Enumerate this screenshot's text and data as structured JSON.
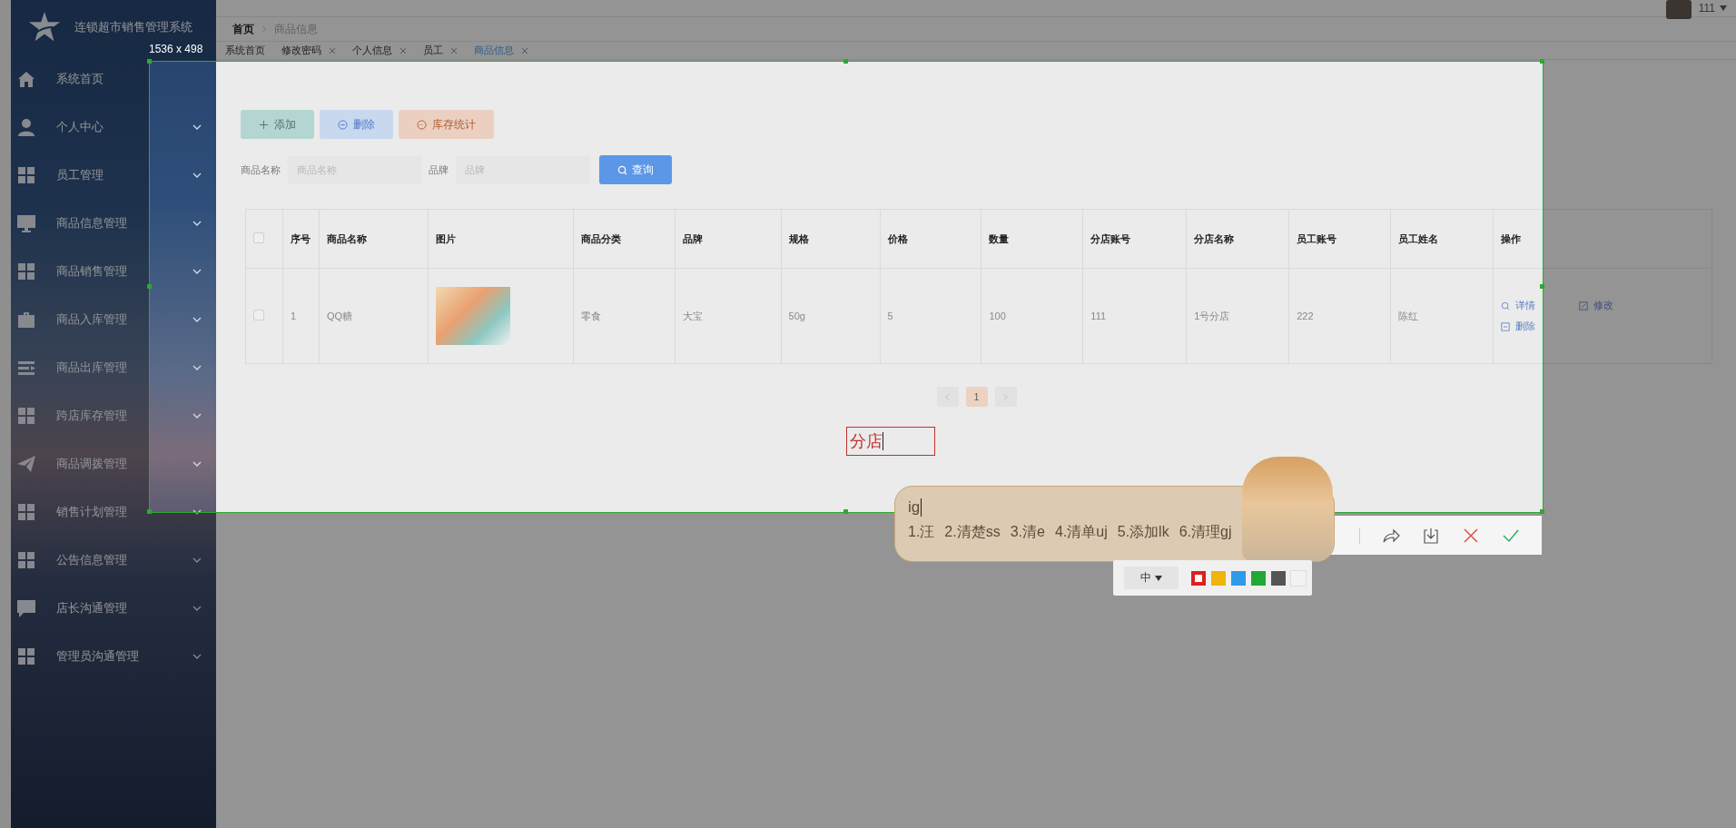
{
  "top_bar": {
    "user": "111"
  },
  "sidebar": {
    "title": "连锁超市销售管理系统",
    "items": [
      {
        "label": "系统首页",
        "kind": "home",
        "submenu": false
      },
      {
        "label": "个人中心",
        "kind": "person",
        "submenu": true
      },
      {
        "label": "员工管理",
        "kind": "grid",
        "submenu": true
      },
      {
        "label": "商品信息管理",
        "kind": "monitor",
        "submenu": true
      },
      {
        "label": "商品销售管理",
        "kind": "grid",
        "submenu": true
      },
      {
        "label": "商品入库管理",
        "kind": "briefcase",
        "submenu": true
      },
      {
        "label": "商品出库管理",
        "kind": "list",
        "submenu": true
      },
      {
        "label": "跨店库存管理",
        "kind": "grid",
        "submenu": true
      },
      {
        "label": "商品调拨管理",
        "kind": "plane",
        "submenu": true
      },
      {
        "label": "销售计划管理",
        "kind": "grid",
        "submenu": true
      },
      {
        "label": "公告信息管理",
        "kind": "grid",
        "submenu": true
      },
      {
        "label": "店长沟通管理",
        "kind": "chat",
        "submenu": true
      },
      {
        "label": "管理员沟通管理",
        "kind": "grid",
        "submenu": true
      }
    ]
  },
  "breadcrumb": [
    "首页",
    "商品信息"
  ],
  "tabs": [
    {
      "label": "系统首页",
      "closable": false,
      "selected": false
    },
    {
      "label": "修改密码",
      "closable": true,
      "selected": false
    },
    {
      "label": "个人信息",
      "closable": true,
      "selected": false
    },
    {
      "label": "员工",
      "closable": true,
      "selected": false
    },
    {
      "label": "商品信息",
      "closable": true,
      "selected": true
    }
  ],
  "actions": [
    {
      "label": "添加",
      "kind": "add"
    },
    {
      "label": "删除",
      "kind": "delete"
    },
    {
      "label": "库存统计",
      "kind": "stats"
    }
  ],
  "search": {
    "fields": [
      {
        "label": "商品名称",
        "placeholder": "商品名称"
      },
      {
        "label": "品牌",
        "placeholder": "品牌"
      }
    ],
    "button": "查询"
  },
  "table": {
    "all_checked": false,
    "columns": [
      {
        "label": "序号",
        "kind": "text"
      },
      {
        "label": "商品名称",
        "kind": "text"
      },
      {
        "label": "图片",
        "kind": "image"
      },
      {
        "label": "商品分类",
        "kind": "text"
      },
      {
        "label": "品牌",
        "kind": "text"
      },
      {
        "label": "规格",
        "kind": "text"
      },
      {
        "label": "价格",
        "kind": "text"
      },
      {
        "label": "数量",
        "kind": "text"
      },
      {
        "label": "分店账号",
        "kind": "text"
      },
      {
        "label": "分店名称",
        "kind": "text"
      },
      {
        "label": "员工账号",
        "kind": "text"
      },
      {
        "label": "员工姓名",
        "kind": "text"
      },
      {
        "label": "操作",
        "kind": "actions"
      }
    ],
    "rows": [
      {
        "checked": false,
        "cells": [
          "1",
          "QQ糖",
          "",
          "零食",
          "大宝",
          "50g",
          "5",
          "100",
          "111",
          "1号分店",
          "222",
          "陈红"
        ],
        "actions": [
          {
            "label": "详情",
            "kind": "view"
          },
          {
            "label": "修改",
            "kind": "edit"
          },
          {
            "label": "删除",
            "kind": "delete"
          }
        ]
      }
    ]
  },
  "pagination": {
    "pages": [
      {
        "label": "1",
        "selected": true
      }
    ]
  },
  "screenshot": {
    "size_label": "1536 x 498",
    "annotation": "分店",
    "ime": {
      "composition": "ig",
      "candidates": [
        "1.汪",
        "2.清楚ss",
        "3.清e",
        "4.清单uj",
        "5.添加lk",
        "6.清理gj"
      ]
    },
    "pen_size": "中",
    "colors": [
      {
        "color": "#e0201c",
        "selected": true
      },
      {
        "color": "#f0b40a",
        "selected": false
      },
      {
        "color": "#2e9ae8",
        "selected": false
      },
      {
        "color": "#22a834",
        "selected": false
      },
      {
        "color": "#555555",
        "selected": false
      },
      {
        "color": "#f2f2f2",
        "selected": false
      }
    ]
  }
}
